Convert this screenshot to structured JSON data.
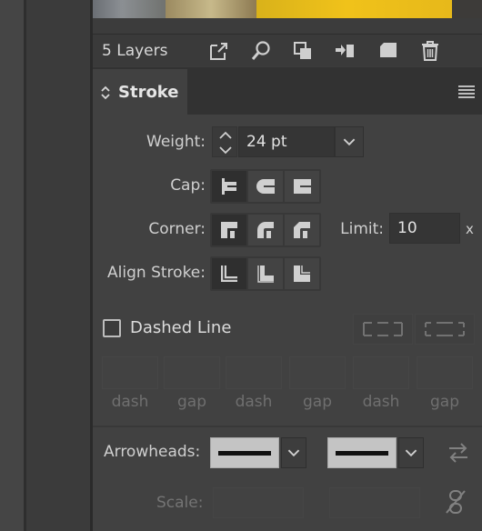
{
  "layers_bar": {
    "count_label": "5 Layers",
    "icons": [
      "export-icon",
      "search-icon",
      "mask-icon",
      "move-to-layer-icon",
      "new-layer-icon",
      "trash-icon"
    ]
  },
  "panel": {
    "tab_title": "Stroke",
    "menu_icon": "hamburger-menu-icon"
  },
  "stroke": {
    "weight_label": "Weight:",
    "weight_value": "24 pt",
    "cap_label": "Cap:",
    "cap_options": [
      "butt-cap",
      "round-cap",
      "projecting-cap"
    ],
    "cap_selected": 0,
    "corner_label": "Corner:",
    "corner_options": [
      "miter-join",
      "round-join",
      "bevel-join"
    ],
    "corner_selected": 0,
    "limit_label": "Limit:",
    "limit_value": "10",
    "limit_unit": "x",
    "align_label": "Align Stroke:",
    "align_options": [
      "align-center",
      "align-inside",
      "align-outside"
    ],
    "align_selected": 0
  },
  "dashed": {
    "label": "Dashed Line",
    "checked": false,
    "fields": [
      "dash",
      "gap",
      "dash",
      "gap",
      "dash",
      "gap"
    ]
  },
  "arrowheads": {
    "label": "Arrowheads:",
    "start": "none",
    "end": "none"
  },
  "scale": {
    "label": "Scale:"
  },
  "colors": {
    "panel_bg": "#414141",
    "selected_seg": "#2f2f2f",
    "highlight_yellow": "#f0c21a"
  }
}
